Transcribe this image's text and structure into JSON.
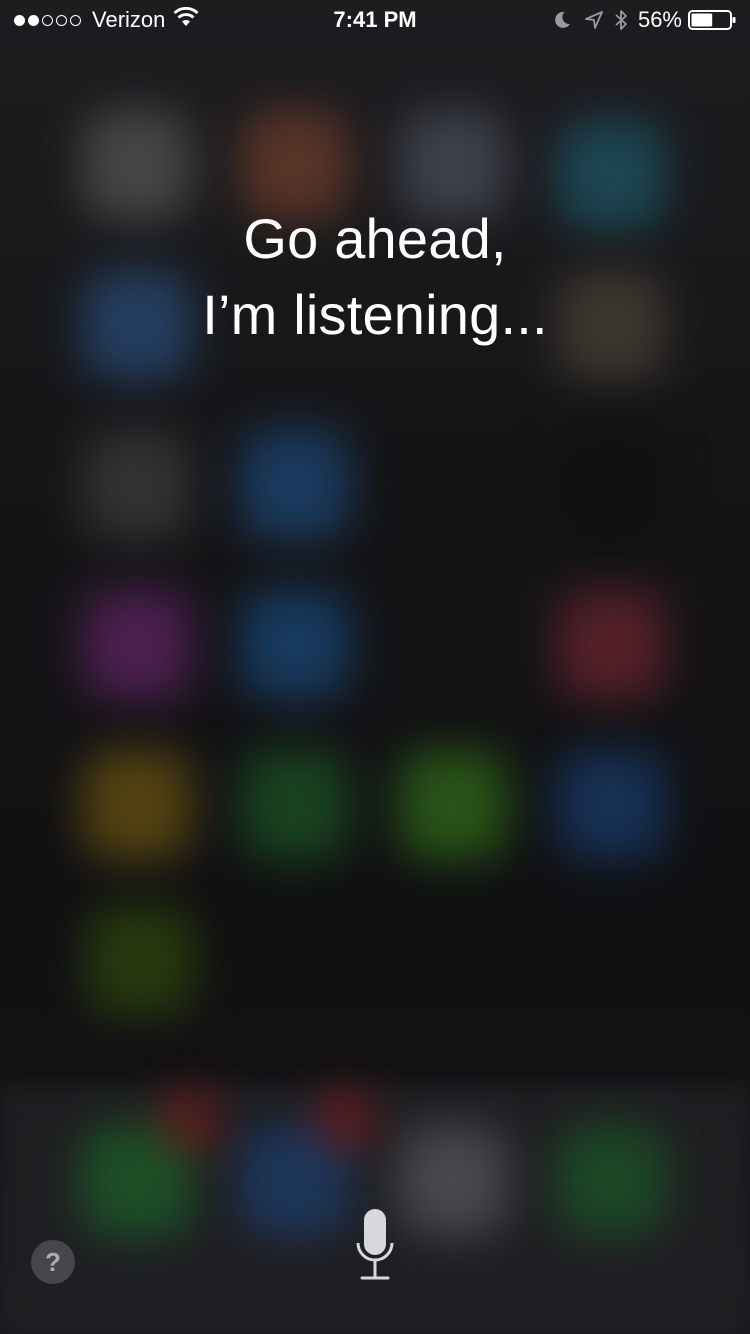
{
  "status_bar": {
    "signal_bars_filled": 2,
    "signal_bars_total": 5,
    "carrier": "Verizon",
    "time": "7:41 PM",
    "battery_percent": "56%",
    "battery_level": 0.56
  },
  "siri": {
    "prompt_line1": "Go ahead,",
    "prompt_line2": "I’m listening..."
  },
  "controls": {
    "help_label": "?"
  }
}
